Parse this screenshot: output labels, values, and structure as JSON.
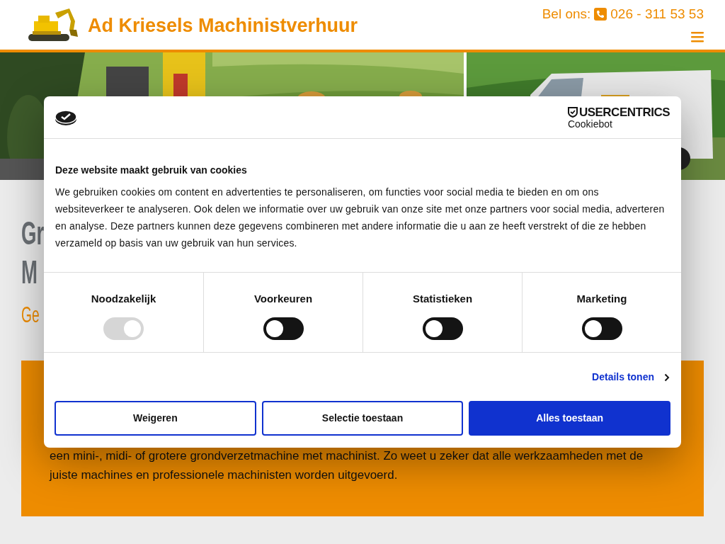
{
  "header": {
    "title": "Ad Kriesels Machinistverhuur",
    "phone_label": "Bel ons:",
    "phone": "026 - 311 53 53"
  },
  "page": {
    "heading_lines": [
      "Gr",
      "M"
    ],
    "subheading": "Ge",
    "intro_lines": [
      "een mini-, midi- of grotere grondverzetmachine met machinist. Zo weet u zeker dat alle werkzaamheden met de",
      "juiste machines en professionele machinisten worden uitgevoerd."
    ]
  },
  "cookie_dialog": {
    "brand": "USERCENTRICS",
    "brand_sub": "Cookiebot",
    "title": "Deze website maakt gebruik van cookies",
    "body": "We gebruiken cookies om content en advertenties te personaliseren, om functies voor social media te bieden en om ons websiteverkeer te analyseren. Ook delen we informatie over uw gebruik van onze site met onze partners voor social media, adverteren en analyse. Deze partners kunnen deze gegevens combineren met andere informatie die u aan ze heeft verstrekt of die ze hebben verzameld op basis van uw gebruik van hun services.",
    "categories": [
      {
        "label": "Noodzakelijk",
        "checked": true,
        "disabled": true
      },
      {
        "label": "Voorkeuren",
        "checked": false,
        "disabled": false
      },
      {
        "label": "Statistieken",
        "checked": false,
        "disabled": false
      },
      {
        "label": "Marketing",
        "checked": false,
        "disabled": false
      }
    ],
    "details_link": "Details tonen",
    "buttons": [
      {
        "label": "Weigeren",
        "kind": "outline"
      },
      {
        "label": "Selectie toestaan",
        "kind": "outline"
      },
      {
        "label": "Alles toestaan",
        "kind": "primary"
      }
    ]
  }
}
